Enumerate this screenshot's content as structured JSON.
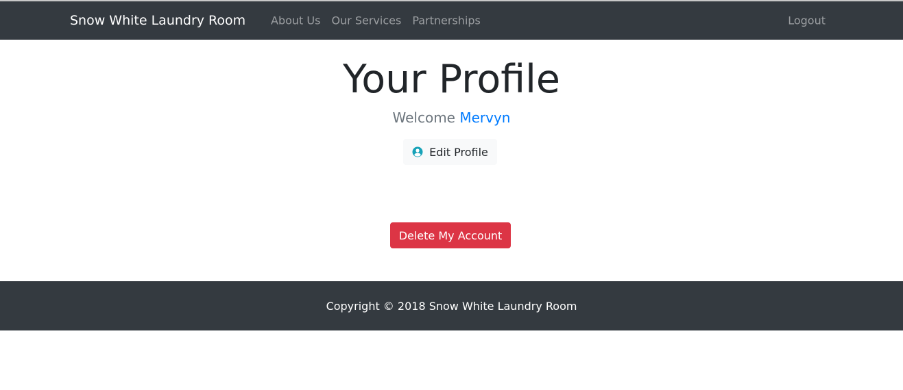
{
  "navbar": {
    "brand": "Snow White Laundry Room",
    "links": [
      {
        "label": "About Us"
      },
      {
        "label": "Our Services"
      },
      {
        "label": "Partnerships"
      }
    ],
    "logout_label": "Logout"
  },
  "main": {
    "title": "Your Profile",
    "welcome_prefix": "Welcome",
    "username": "Mervyn",
    "edit_profile_label": "Edit Profile",
    "edit_profile_icon": "user-circle-icon",
    "delete_account_label": "Delete My Account"
  },
  "footer": {
    "copyright": "Copyright © 2018 Snow White Laundry Room"
  },
  "colors": {
    "navbar_bg": "#343a40",
    "primary": "#007bff",
    "danger": "#dc3545",
    "icon_teal": "#17a2b8",
    "muted": "#6c757d"
  }
}
